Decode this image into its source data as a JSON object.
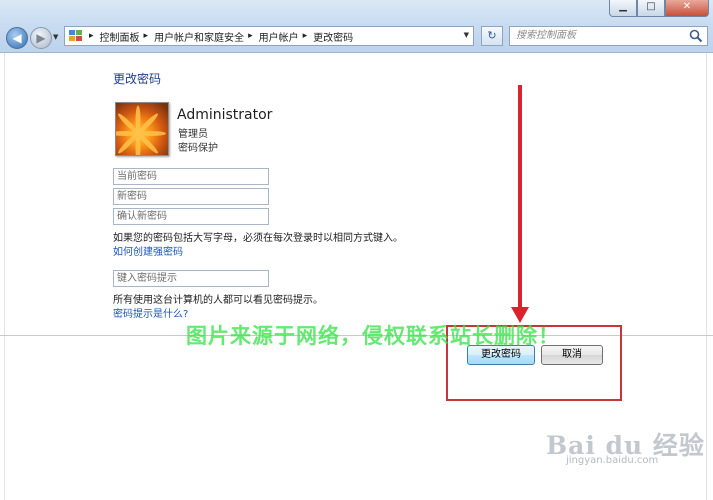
{
  "window": {
    "minimize_label": "▁",
    "maximize_label": "□",
    "close_label": "✕"
  },
  "nav": {
    "back_glyph": "◀",
    "forward_glyph": "▶",
    "dropdown_glyph": "▼",
    "refresh_glyph": "↻"
  },
  "breadcrumbs": [
    {
      "label": "控制面板"
    },
    {
      "label": "用户帐户和家庭安全"
    },
    {
      "label": "用户帐户"
    },
    {
      "label": "更改密码"
    }
  ],
  "breadcrumb_separator": "▸",
  "search": {
    "placeholder": "搜索控制面板"
  },
  "page": {
    "title": "更改密码"
  },
  "user": {
    "name": "Administrator",
    "role": "管理员",
    "status": "密码保护"
  },
  "form": {
    "current_password_placeholder": "当前密码",
    "new_password_placeholder": "新密码",
    "confirm_password_placeholder": "确认新密码",
    "case_note": "如果您的密码包括大写字母，必须在每次登录时以相同方式键入。",
    "strong_password_link": "如何创建强密码",
    "hint_placeholder": "键入密码提示",
    "hint_note": "所有使用这台计算机的人都可以看见密码提示。",
    "hint_link": "密码提示是什么?"
  },
  "buttons": {
    "change_password": "更改密码",
    "cancel": "取消"
  },
  "overlay": {
    "watermark": "图片来源于网络，侵权联系站长删除！",
    "baidu_logo": "Bai du 经验",
    "baidu_url": "jingyan.baidu.com"
  },
  "colors": {
    "link": "#1b56b5",
    "title": "#1e3f8c",
    "annotation_red": "#d9232e",
    "watermark_green": "#39e44a"
  }
}
